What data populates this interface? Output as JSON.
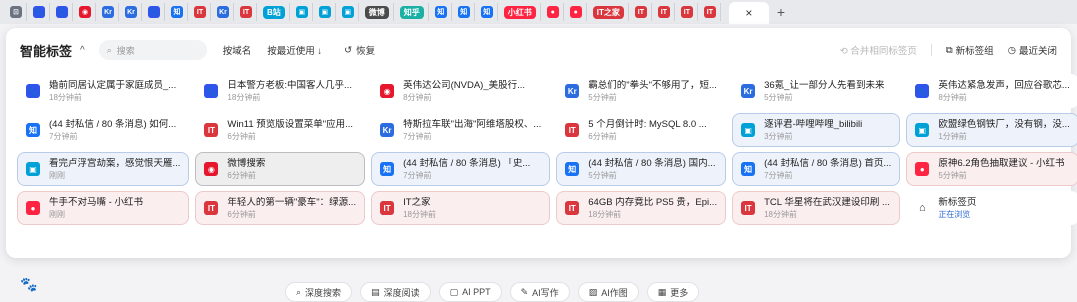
{
  "tab_strip": {
    "tabs": [
      {
        "type": "icon",
        "glyph": "⊡",
        "color": "#6b7280",
        "name": "grid-icon"
      },
      {
        "type": "icon",
        "glyph": "🐾",
        "color": "#2f54eb",
        "name": "baidu-icon"
      },
      {
        "type": "icon",
        "glyph": "🐾",
        "color": "#2f54eb",
        "name": "baidu-icon"
      },
      {
        "type": "icon",
        "glyph": "◉",
        "color": "#e6162d",
        "name": "weibo-icon"
      },
      {
        "type": "icon",
        "glyph": "Kr",
        "color": "#2b6de0",
        "name": "36kr-icon"
      },
      {
        "type": "icon",
        "glyph": "Kr",
        "color": "#2b6de0",
        "name": "36kr-icon"
      },
      {
        "type": "icon",
        "glyph": "🐾",
        "color": "#2f54eb",
        "name": "baidu-icon"
      },
      {
        "type": "icon",
        "glyph": "知",
        "color": "#1772f6",
        "name": "zhihu-icon"
      },
      {
        "type": "icon",
        "glyph": "IT",
        "color": "#d9363e",
        "name": "ithome-icon"
      },
      {
        "type": "icon",
        "glyph": "Kr",
        "color": "#2b6de0",
        "name": "36kr-icon"
      },
      {
        "type": "icon",
        "glyph": "IT",
        "color": "#d9363e",
        "name": "ithome-icon"
      },
      {
        "type": "pill",
        "label": "B站",
        "color": "#00a1d6",
        "name": "bilibili-pill"
      },
      {
        "type": "icon",
        "glyph": "▣",
        "color": "#00a1d6",
        "name": "bilibili-icon"
      },
      {
        "type": "icon",
        "glyph": "▣",
        "color": "#00a1d6",
        "name": "bilibili-icon"
      },
      {
        "type": "icon",
        "glyph": "▣",
        "color": "#00a1d6",
        "name": "bilibili-icon"
      },
      {
        "type": "pill",
        "label": "微博",
        "color": "#4b4b4b",
        "name": "weibo-pill"
      },
      {
        "type": "pill",
        "label": "知乎",
        "color": "#1ab0a3",
        "name": "zhihu-pill"
      },
      {
        "type": "icon",
        "glyph": "知",
        "color": "#1772f6",
        "name": "zhihu-icon"
      },
      {
        "type": "icon",
        "glyph": "知",
        "color": "#1772f6",
        "name": "zhihu-icon"
      },
      {
        "type": "icon",
        "glyph": "知",
        "color": "#1772f6",
        "name": "zhihu-icon"
      },
      {
        "type": "pill",
        "label": "小红书",
        "color": "#ff2442",
        "name": "xiaohongshu-pill"
      },
      {
        "type": "icon",
        "glyph": "●",
        "color": "#ff2442",
        "name": "xiaohongshu-icon"
      },
      {
        "type": "icon",
        "glyph": "●",
        "color": "#ff2442",
        "name": "xiaohongshu-icon"
      },
      {
        "type": "pill",
        "label": "IT之家",
        "color": "#d9363e",
        "name": "ithome-pill"
      },
      {
        "type": "icon",
        "glyph": "IT",
        "color": "#d9363e",
        "name": "ithome-icon"
      },
      {
        "type": "icon",
        "glyph": "IT",
        "color": "#d9363e",
        "name": "ithome-icon"
      },
      {
        "type": "icon",
        "glyph": "IT",
        "color": "#d9363e",
        "name": "ithome-icon"
      },
      {
        "type": "icon",
        "glyph": "IT",
        "color": "#d9363e",
        "name": "ithome-icon"
      }
    ],
    "active_close": "×",
    "new_tab": "+"
  },
  "header": {
    "title": "智能标签",
    "collapse": "^",
    "search_placeholder": "搜索",
    "sort_domain": "按域名",
    "sort_recent": "按最近使用 ↓",
    "restore": "恢复",
    "merge_same": "合并相同标签页",
    "new_group": "新标签组",
    "recent_closed": "最近关闭"
  },
  "cards": [
    {
      "title": "婚前同居认定属于家庭成员_...",
      "time": "18分钟前",
      "icon": "🐾",
      "icolor": "#2f54eb",
      "style": "white",
      "name": "baidu-icon"
    },
    {
      "title": "日本警方老板:中国客人几乎...",
      "time": "18分钟前",
      "icon": "🐾",
      "icolor": "#2f54eb",
      "style": "white",
      "name": "baidu-icon"
    },
    {
      "title": "英伟达公司(NVDA)_美股行...",
      "time": "8分钟前",
      "icon": "◉",
      "icolor": "#e6162d",
      "style": "white",
      "name": "weibo-icon"
    },
    {
      "title": "霸总们的\"拳头\"不够用了，短...",
      "time": "5分钟前",
      "icon": "Kr",
      "icolor": "#2b6de0",
      "style": "white",
      "name": "36kr-icon"
    },
    {
      "title": "36氪_让一部分人先看到未来",
      "time": "5分钟前",
      "icon": "Kr",
      "icolor": "#2b6de0",
      "style": "white",
      "name": "36kr-icon"
    },
    {
      "title": "英伟达紧急发声，回应谷歌芯...",
      "time": "8分钟前",
      "icon": "🐾",
      "icolor": "#2f54eb",
      "style": "white",
      "name": "baidu-icon"
    },
    {
      "title": "(44 封私信 / 80 条消息) 如何...",
      "time": "7分钟前",
      "icon": "知",
      "icolor": "#1772f6",
      "style": "white",
      "name": "zhihu-icon"
    },
    {
      "title": "Win11 预览版设置菜单\"应用...",
      "time": "6分钟前",
      "icon": "IT",
      "icolor": "#d9363e",
      "style": "white",
      "name": "ithome-icon"
    },
    {
      "title": "特斯拉车联\"出海\"阿维塔股权、...",
      "time": "7分钟前",
      "icon": "Kr",
      "icolor": "#2b6de0",
      "style": "white",
      "name": "36kr-icon"
    },
    {
      "title": "5 个月倒计时: MySQL 8.0 ...",
      "time": "6分钟前",
      "icon": "IT",
      "icolor": "#d9363e",
      "style": "white",
      "name": "ithome-icon"
    },
    {
      "title": "逐评君-哔哩哔哩_bilibili",
      "time": "3分钟前",
      "icon": "▣",
      "icolor": "#00a1d6",
      "style": "blue",
      "name": "bilibili-icon"
    },
    {
      "title": "欧盟绿色钢铁厂，没有钢，没...",
      "time": "1分钟前",
      "icon": "▣",
      "icolor": "#00a1d6",
      "style": "blue",
      "name": "bilibili-icon"
    },
    {
      "title": "看完卢浮宫劫案，感觉恨天雁...",
      "time": "刚刚",
      "icon": "▣",
      "icolor": "#00a1d6",
      "style": "blue",
      "name": "bilibili-icon"
    },
    {
      "title": "微博搜索",
      "time": "6分钟前",
      "icon": "◉",
      "icolor": "#e6162d",
      "style": "gray",
      "name": "weibo-icon"
    },
    {
      "title": "(44 封私信 / 80 条消息) 「史...",
      "time": "7分钟前",
      "icon": "知",
      "icolor": "#1772f6",
      "style": "blue",
      "name": "zhihu-icon"
    },
    {
      "title": "(44 封私信 / 80 条消息) 国内...",
      "time": "5分钟前",
      "icon": "知",
      "icolor": "#1772f6",
      "style": "blue",
      "name": "zhihu-icon"
    },
    {
      "title": "(44 封私信 / 80 条消息) 首页...",
      "time": "7分钟前",
      "icon": "知",
      "icolor": "#1772f6",
      "style": "blue",
      "name": "zhihu-icon"
    },
    {
      "title": "原神6.2角色抽取建议 - 小红书",
      "time": "5分钟前",
      "icon": "●",
      "icolor": "#ff2442",
      "style": "red",
      "name": "xiaohongshu-icon"
    },
    {
      "title": "牛手不对马嘴 - 小红书",
      "time": "刚刚",
      "icon": "●",
      "icolor": "#ff2442",
      "style": "red",
      "name": "xiaohongshu-icon"
    },
    {
      "title": "年轻人的第一辆\"豪车\"：绿源...",
      "time": "6分钟前",
      "icon": "IT",
      "icolor": "#d9363e",
      "style": "red",
      "name": "ithome-icon"
    },
    {
      "title": "IT之家",
      "time": "18分钟前",
      "icon": "IT",
      "icolor": "#d9363e",
      "style": "red",
      "name": "ithome-icon"
    },
    {
      "title": "64GB 内存竟比 PS5 贵，Epi...",
      "time": "18分钟前",
      "icon": "IT",
      "icolor": "#d9363e",
      "style": "red",
      "name": "ithome-icon"
    },
    {
      "title": "TCL 华星将在武汉建设印刷 ...",
      "time": "18分钟前",
      "icon": "IT",
      "icolor": "#d9363e",
      "style": "red",
      "name": "ithome-icon"
    },
    {
      "title": "新标签页",
      "time": "正在浏览",
      "icon": "⌂",
      "icolor": "#ffffff",
      "style": "white",
      "name": "home-icon",
      "live": true
    }
  ],
  "bottom": {
    "buttons": [
      "深度搜索",
      "深度阅读",
      "AI PPT",
      "AI写作",
      "AI作图",
      "更多"
    ]
  }
}
